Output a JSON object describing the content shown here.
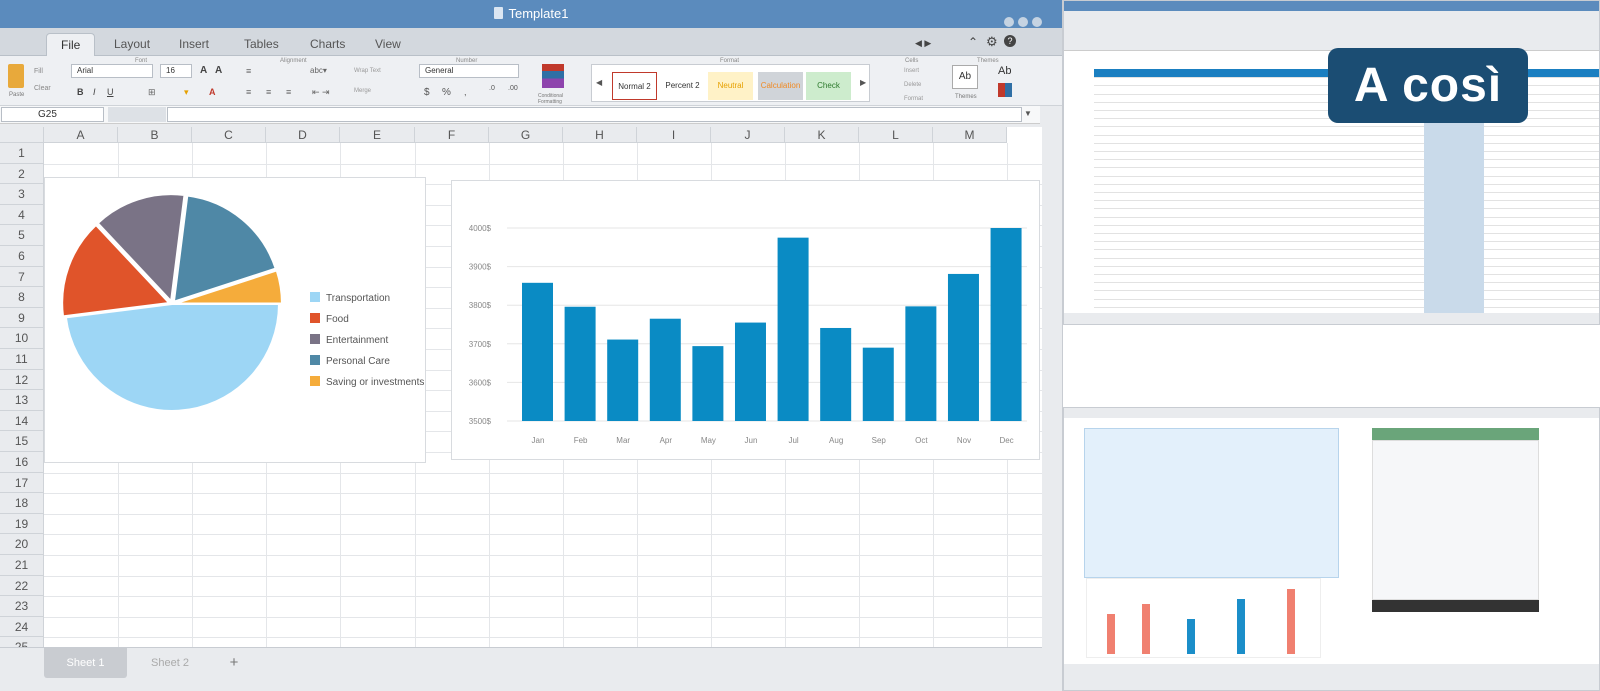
{
  "window": {
    "title": "Template1"
  },
  "menu": {
    "tabs": [
      "File",
      "Layout",
      "Insert",
      "Tables",
      "Charts",
      "View"
    ]
  },
  "ribbon": {
    "groups": [
      "Font",
      "Alignment",
      "Number",
      "Format",
      "Cells",
      "Themes"
    ],
    "paste": "Paste",
    "fill": "Fill",
    "clear": "Clear",
    "font_name": "Arial",
    "font_size": "16",
    "wrap": "Wrap Text",
    "merge": "Merge",
    "number_format": "General",
    "conditional": "Conditional Formatting",
    "styles": [
      "Normal 2",
      "Percent 2",
      "Neutral",
      "Calculation",
      "Check"
    ],
    "insert": "Insert",
    "delete": "Delete",
    "format": "Format",
    "themes": "Themes"
  },
  "formula_bar": {
    "cell_ref": "G25",
    "value": ""
  },
  "columns": [
    "A",
    "B",
    "C",
    "D",
    "E",
    "F",
    "G",
    "H",
    "I",
    "J",
    "K",
    "L",
    "M"
  ],
  "rows": [
    "1",
    "2",
    "3",
    "4",
    "5",
    "6",
    "7",
    "8",
    "9",
    "10",
    "11",
    "12",
    "13",
    "14",
    "15",
    "16",
    "17",
    "18",
    "19",
    "20",
    "21",
    "22",
    "23",
    "24",
    "25"
  ],
  "chart_data": [
    {
      "type": "pie",
      "categories": [
        "Transportation",
        "Food",
        "Entertainment",
        "Personal Care",
        "Saving or investments"
      ],
      "values": [
        48,
        15,
        14,
        18,
        5
      ],
      "colors": [
        "#9dd6f5",
        "#e0542a",
        "#7a7386",
        "#4f88a6",
        "#f5ac3b"
      ]
    },
    {
      "type": "bar",
      "categories": [
        "Jan",
        "Feb",
        "Mar",
        "Apr",
        "May",
        "Jun",
        "Jul",
        "Aug",
        "Sep",
        "Oct",
        "Nov",
        "Dec"
      ],
      "values": [
        3858,
        3796,
        3711,
        3765,
        3694,
        3755,
        3975,
        3741,
        3690,
        3797,
        3881,
        4000
      ],
      "ylim": [
        3500,
        4000
      ],
      "yticks": [
        "4000$",
        "3900$",
        "3800$",
        "3700$",
        "3600$",
        "3500$"
      ],
      "color": "#0a8bc4",
      "grid": true
    }
  ],
  "sheets": {
    "tabs": [
      "Sheet 1",
      "Sheet 2"
    ],
    "add": "+"
  },
  "badge": {
    "text": "A così"
  }
}
